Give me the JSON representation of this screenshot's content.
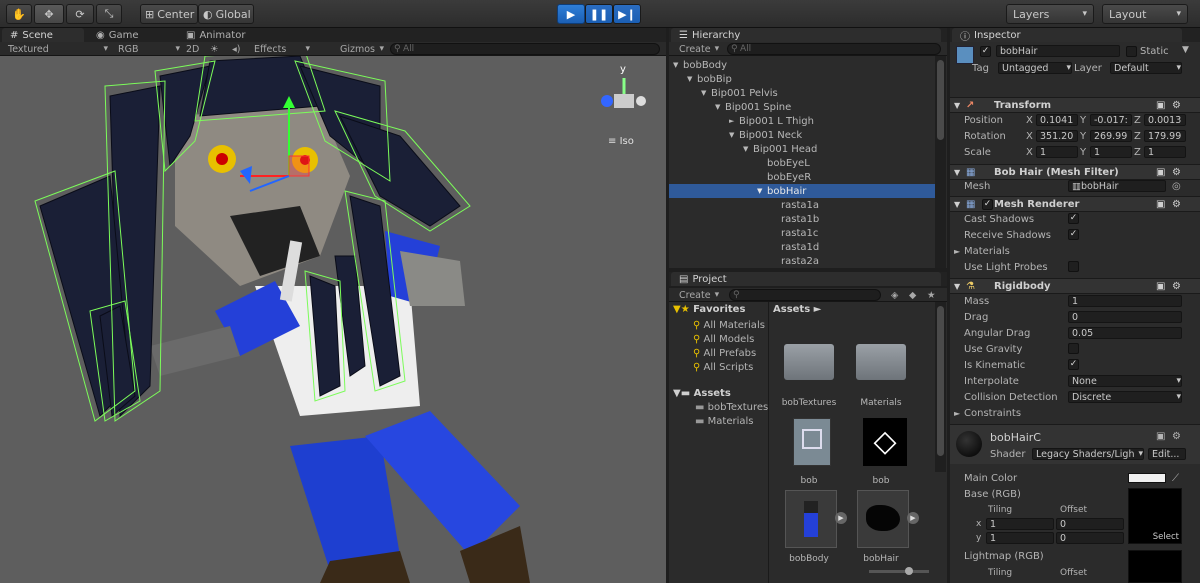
{
  "toolbar": {
    "pivot": "Center",
    "space": "Global",
    "layers": "Layers",
    "layout": "Layout"
  },
  "tabs": {
    "scene": "Scene",
    "game": "Game",
    "animator": "Animator",
    "hierarchy": "Hierarchy",
    "project": "Project",
    "inspector": "Inspector"
  },
  "scene_bar": {
    "shading": "Textured",
    "render_mode": "RGB",
    "mode2d": "2D",
    "effects": "Effects",
    "gizmos": "Gizmos",
    "search": "All",
    "iso": "Iso",
    "gizmo_axis": "y"
  },
  "hierarchy": {
    "create": "Create",
    "search": "All",
    "items": [
      {
        "label": "bobBody",
        "depth": 0,
        "arrow": "▼"
      },
      {
        "label": "bobBip",
        "depth": 1,
        "arrow": "▼"
      },
      {
        "label": "Bip001 Pelvis",
        "depth": 2,
        "arrow": "▼"
      },
      {
        "label": "Bip001 Spine",
        "depth": 3,
        "arrow": "▼"
      },
      {
        "label": "Bip001 L Thigh",
        "depth": 4,
        "arrow": "►"
      },
      {
        "label": "Bip001 Neck",
        "depth": 4,
        "arrow": "▼"
      },
      {
        "label": "Bip001 Head",
        "depth": 5,
        "arrow": "▼"
      },
      {
        "label": "bobEyeL",
        "depth": 6,
        "arrow": ""
      },
      {
        "label": "bobEyeR",
        "depth": 6,
        "arrow": ""
      },
      {
        "label": "bobHair",
        "depth": 6,
        "arrow": "▼",
        "selected": true
      },
      {
        "label": "rasta1a",
        "depth": 7,
        "arrow": ""
      },
      {
        "label": "rasta1b",
        "depth": 7,
        "arrow": ""
      },
      {
        "label": "rasta1c",
        "depth": 7,
        "arrow": ""
      },
      {
        "label": "rasta1d",
        "depth": 7,
        "arrow": ""
      },
      {
        "label": "rasta2a",
        "depth": 7,
        "arrow": ""
      }
    ]
  },
  "project": {
    "create": "Create",
    "favorites": "Favorites",
    "fav_items": [
      "All Materials",
      "All Models",
      "All Prefabs",
      "All Scripts"
    ],
    "assets": "Assets",
    "asset_folders": [
      "bobTextures",
      "Materials"
    ],
    "breadcrumb": "Assets ►",
    "grid": [
      {
        "label": "bobTextures",
        "kind": "folder"
      },
      {
        "label": "Materials",
        "kind": "folder"
      },
      {
        "label": "bob",
        "kind": "model"
      },
      {
        "label": "bob",
        "kind": "unity"
      },
      {
        "label": "bobBody",
        "kind": "prefab"
      },
      {
        "label": "bobHair",
        "kind": "mesh"
      }
    ]
  },
  "inspector": {
    "object_name": "bobHair",
    "static": "Static",
    "tag_label": "Tag",
    "tag": "Untagged",
    "layer_label": "Layer",
    "layer": "Default",
    "transform": {
      "title": "Transform",
      "position_label": "Position",
      "rotation_label": "Rotation",
      "scale_label": "Scale",
      "position": [
        "0.1041",
        "-0.017:",
        "0.0013"
      ],
      "rotation": [
        "351.20",
        "269.99",
        "179.99"
      ],
      "scale": [
        "1",
        "1",
        "1"
      ],
      "axes": [
        "X",
        "Y",
        "Z"
      ]
    },
    "mesh_filter": {
      "title": "Bob Hair (Mesh Filter)",
      "mesh_label": "Mesh",
      "mesh": "bobHair"
    },
    "mesh_renderer": {
      "title": "Mesh Renderer",
      "cast_shadows": "Cast Shadows",
      "receive_shadows": "Receive Shadows",
      "materials": "Materials",
      "light_probes": "Use Light Probes"
    },
    "rigidbody": {
      "title": "Rigidbody",
      "mass_label": "Mass",
      "mass": "1",
      "drag_label": "Drag",
      "drag": "0",
      "angdrag_label": "Angular Drag",
      "angdrag": "0.05",
      "gravity": "Use Gravity",
      "kinematic": "Is Kinematic",
      "interp_label": "Interpolate",
      "interp": "None",
      "coll_label": "Collision Detection",
      "coll": "Discrete",
      "constraints": "Constraints"
    },
    "material": {
      "name": "bobHairC",
      "shader_label": "Shader",
      "shader": "Legacy Shaders/Ligh",
      "edit": "Edit...",
      "main_color": "Main Color",
      "base": "Base (RGB)",
      "tiling": "Tiling",
      "offset": "Offset",
      "x": "x",
      "y": "y",
      "tx": "1",
      "ox": "0",
      "ty": "1",
      "oy": "0",
      "select": "Select",
      "lightmap": "Lightmap (RGB)"
    }
  },
  "colors": {
    "selection": "#2f5a9a",
    "play": "#2f7fd8",
    "wire": "#7cfc5a"
  }
}
